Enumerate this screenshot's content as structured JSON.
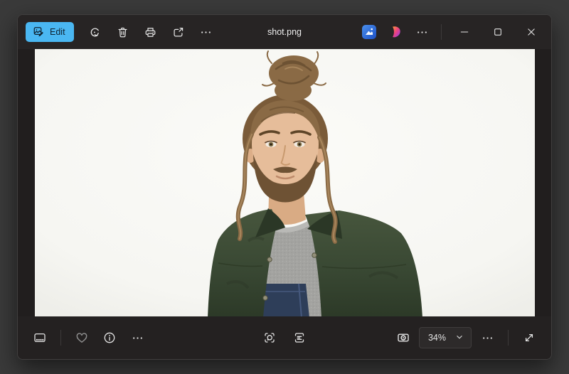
{
  "window": {
    "title": "shot.png",
    "accent_color": "#4ab7f2",
    "outer_background": "#3a3a3a",
    "chrome_background": "#272424",
    "content_background": "#211e1e"
  },
  "titlebar": {
    "edit_label": "Edit",
    "left_icons": [
      "edit-image-icon",
      "rotate-icon",
      "delete-icon",
      "print-icon",
      "share-icon",
      "more-icon"
    ],
    "right_icons": [
      "edit-with-designer-icon",
      "designer-logo-icon",
      "more-icon",
      "minimize-icon",
      "maximize-icon",
      "close-icon"
    ]
  },
  "toolbar": {
    "zoom_level": "34%",
    "left_icons": [
      "filmstrip-icon",
      "favorite-heart-icon",
      "info-icon",
      "more-icon"
    ],
    "center_icons": [
      "visual-search-icon",
      "text-actions-icon"
    ],
    "right_icons": [
      "zoom-fit-icon",
      "chevron-down-icon",
      "more-icon",
      "fullscreen-icon"
    ]
  },
  "photo": {
    "description": "Studio portrait of a young man with light-brown hair in a messy top bun and loose wavy strands, a trimmed beard, wearing a dark green suede jacket over a grey marled crew-neck sweater and dark denim overalls, against a white background."
  }
}
